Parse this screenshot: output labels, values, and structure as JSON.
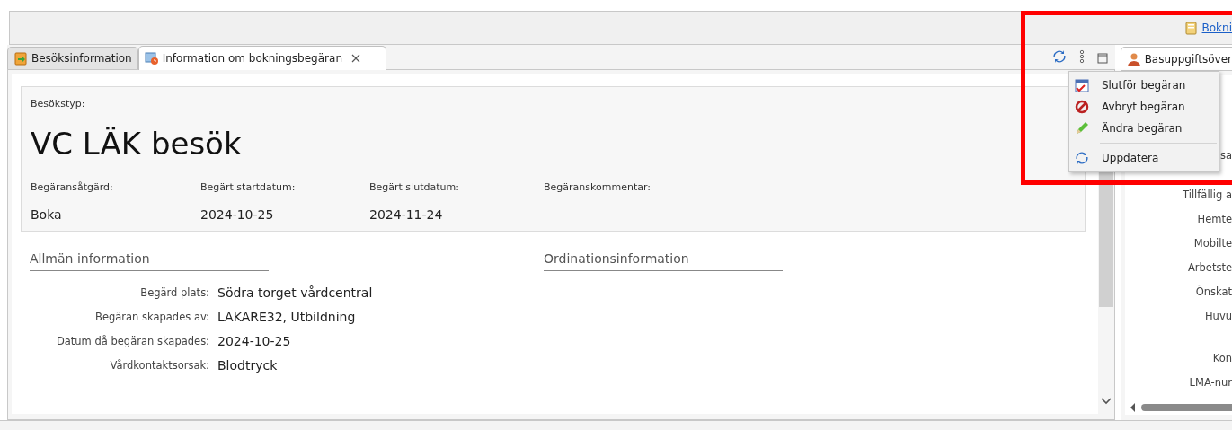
{
  "top_bar": {
    "link": "Bokni"
  },
  "tabs": [
    {
      "label": "Besöksinformation",
      "kind": "clipboard",
      "selected": false,
      "closable": false
    },
    {
      "label": "Information om bokningsbegäran",
      "kind": "calendar",
      "selected": true,
      "closable": true
    }
  ],
  "request": {
    "type_label": "Besökstyp:",
    "type_value": "VC LÄK besök",
    "fields": [
      {
        "label": "Begäransåtgärd:",
        "value": "Boka"
      },
      {
        "label": "Begärt startdatum:",
        "value": "2024-10-25"
      },
      {
        "label": "Begärt slutdatum:",
        "value": "2024-11-24"
      },
      {
        "label": "Begäranskommentar:"
      }
    ]
  },
  "general": {
    "title": "Allmän information",
    "rows": [
      {
        "label": "Begärd plats:",
        "value": "Södra torget vårdcentral"
      },
      {
        "label": "Begäran skapades av:",
        "value": "LAKARE32, Utbildning"
      },
      {
        "label": "Datum då begäran skapades:",
        "value": "2024-10-25"
      },
      {
        "label": "Vårdkontaktsorsak:",
        "value": "Blodtryck"
      }
    ]
  },
  "prescription": {
    "title": "Ordinationsinformation"
  },
  "menu": [
    {
      "label": "Slutför begäran",
      "kind": "complete",
      "separator_before": false
    },
    {
      "label": "Avbryt begäran",
      "kind": "cancel",
      "separator_before": false
    },
    {
      "label": "Ändra begäran",
      "kind": "edit",
      "separator_before": false
    },
    {
      "label": "Uppdatera",
      "kind": "refresh",
      "separator_before": true
    }
  ],
  "right_panel": {
    "tab": "Basuppgiftsöver",
    "labels": [
      "sa",
      "Tillfällig a",
      "Hemte",
      "Mobilte",
      "Arbetste",
      "Önskat",
      "Huvu",
      "Kon",
      "LMA-nur"
    ]
  },
  "highlight_frame": true
}
